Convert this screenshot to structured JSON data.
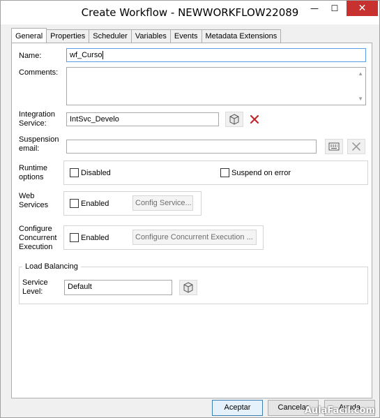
{
  "window": {
    "title": "Create Workflow - NEWWORKFLOW22089",
    "minimize_glyph": "—",
    "maximize_glyph": "☐",
    "close_glyph": "✕"
  },
  "tabs": [
    {
      "label": "General",
      "active": true
    },
    {
      "label": "Properties",
      "active": false
    },
    {
      "label": "Scheduler",
      "active": false
    },
    {
      "label": "Variables",
      "active": false
    },
    {
      "label": "Events",
      "active": false
    },
    {
      "label": "Metadata Extensions",
      "active": false
    }
  ],
  "general": {
    "name_label": "Name:",
    "name_value": "wf_Curso",
    "comments_label": "Comments:",
    "comments_value": "",
    "integration_label": "Integration Service:",
    "integration_value": "IntSvc_Develo",
    "suspension_label": "Suspension email:",
    "suspension_value": "",
    "runtime_label": "Runtime options",
    "disabled_label": "Disabled",
    "suspend_on_error_label": "Suspend on error",
    "web_services_label": "Web Services",
    "web_enabled_label": "Enabled",
    "config_service_label": "Config Service...",
    "concurrent_label": "Configure Concurrent Execution",
    "concurrent_enabled_label": "Enabled",
    "configure_concurrent_button": "Configure Concurrent Execution ...",
    "load_balancing_legend": "Load Balancing",
    "service_level_label": "Service Level:",
    "service_level_value": "Default"
  },
  "buttons": {
    "accept": "Aceptar",
    "cancel": "Cancelar",
    "help": "Ayuda"
  },
  "watermark": "AulaFacil.com",
  "colors": {
    "close_button": "#c7312f",
    "delete_icon": "#c0262c",
    "focus_border": "#569de5"
  }
}
